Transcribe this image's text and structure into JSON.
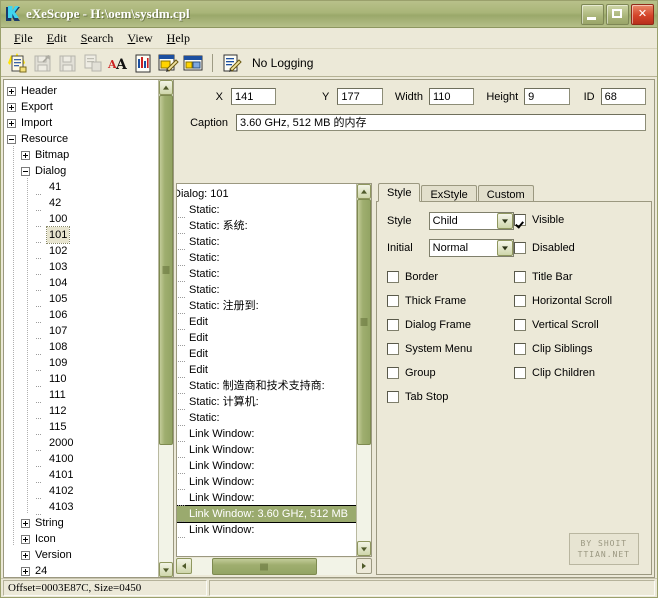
{
  "window": {
    "title": "eXeScope - H:\\oem\\sysdm.cpl",
    "icon": "app-icon",
    "minimize_label": "",
    "maximize_label": "",
    "close_label": "✕",
    "accent_title": "#a9b578",
    "accent_close": "#d4452a",
    "background": "#ece9d8"
  },
  "menu": {
    "items": [
      {
        "label": "File",
        "accel": "F",
        "rest": "ile"
      },
      {
        "label": "Edit",
        "accel": "E",
        "rest": "dit"
      },
      {
        "label": "Search",
        "accel": "S",
        "rest": "earch"
      },
      {
        "label": "View",
        "accel": "V",
        "rest": "iew"
      },
      {
        "label": "Help",
        "accel": "H",
        "rest": "elp"
      }
    ]
  },
  "toolbar": {
    "buttons": [
      {
        "name": "open-file-icon",
        "enabled": true
      },
      {
        "name": "save-as-icon",
        "enabled": false
      },
      {
        "name": "save-icon",
        "enabled": false
      },
      {
        "name": "save-copy-icon",
        "enabled": false
      },
      {
        "name": "font-icon",
        "enabled": true
      },
      {
        "name": "properties-icon",
        "enabled": true
      },
      {
        "name": "edit-resource-icon",
        "enabled": true
      },
      {
        "name": "dialog-editor-icon",
        "enabled": true
      },
      {
        "name": "logging-icon",
        "enabled": true
      }
    ],
    "logging_label": "No Logging"
  },
  "tree": {
    "items": [
      {
        "label": "Header",
        "depth": 0,
        "toggle": "plus"
      },
      {
        "label": "Export",
        "depth": 0,
        "toggle": "plus"
      },
      {
        "label": "Import",
        "depth": 0,
        "toggle": "plus"
      },
      {
        "label": "Resource",
        "depth": 0,
        "toggle": "minus"
      },
      {
        "label": "Bitmap",
        "depth": 1,
        "toggle": "plus"
      },
      {
        "label": "Dialog",
        "depth": 1,
        "toggle": "minus"
      },
      {
        "label": "41",
        "depth": 2,
        "toggle": "none"
      },
      {
        "label": "42",
        "depth": 2,
        "toggle": "none"
      },
      {
        "label": "100",
        "depth": 2,
        "toggle": "none"
      },
      {
        "label": "101",
        "depth": 2,
        "toggle": "none",
        "selected": true
      },
      {
        "label": "102",
        "depth": 2,
        "toggle": "none"
      },
      {
        "label": "103",
        "depth": 2,
        "toggle": "none"
      },
      {
        "label": "104",
        "depth": 2,
        "toggle": "none"
      },
      {
        "label": "105",
        "depth": 2,
        "toggle": "none"
      },
      {
        "label": "106",
        "depth": 2,
        "toggle": "none"
      },
      {
        "label": "107",
        "depth": 2,
        "toggle": "none"
      },
      {
        "label": "108",
        "depth": 2,
        "toggle": "none"
      },
      {
        "label": "109",
        "depth": 2,
        "toggle": "none"
      },
      {
        "label": "110",
        "depth": 2,
        "toggle": "none"
      },
      {
        "label": "111",
        "depth": 2,
        "toggle": "none"
      },
      {
        "label": "112",
        "depth": 2,
        "toggle": "none"
      },
      {
        "label": "115",
        "depth": 2,
        "toggle": "none"
      },
      {
        "label": "2000",
        "depth": 2,
        "toggle": "none"
      },
      {
        "label": "4100",
        "depth": 2,
        "toggle": "none"
      },
      {
        "label": "4101",
        "depth": 2,
        "toggle": "none"
      },
      {
        "label": "4102",
        "depth": 2,
        "toggle": "none"
      },
      {
        "label": "4103",
        "depth": 2,
        "toggle": "none"
      },
      {
        "label": "String",
        "depth": 1,
        "toggle": "plus"
      },
      {
        "label": "Icon",
        "depth": 1,
        "toggle": "plus"
      },
      {
        "label": "Version",
        "depth": 1,
        "toggle": "plus"
      },
      {
        "label": "24",
        "depth": 1,
        "toggle": "plus"
      }
    ]
  },
  "properties": {
    "x_label": "X",
    "x_value": "141",
    "y_label": "Y",
    "y_value": "177",
    "width_label": "Width",
    "width_value": "110",
    "height_label": "Height",
    "height_value": "9",
    "id_label": "ID",
    "id_value": "68",
    "caption_label": "Caption",
    "caption_value": "3.60 GHz, 512 MB 的内存"
  },
  "controls_list": {
    "header": "Dialog: 101",
    "items": [
      {
        "label": "Static:"
      },
      {
        "label": "Static: 系统:"
      },
      {
        "label": "Static:"
      },
      {
        "label": "Static:"
      },
      {
        "label": "Static:"
      },
      {
        "label": "Static:"
      },
      {
        "label": "Static: 注册到:"
      },
      {
        "label": "Edit"
      },
      {
        "label": "Edit"
      },
      {
        "label": "Edit"
      },
      {
        "label": "Edit"
      },
      {
        "label": "Static: 制造商和技术支持商:"
      },
      {
        "label": "Static: 计算机:"
      },
      {
        "label": "Static:"
      },
      {
        "label": "Link Window:"
      },
      {
        "label": "Link Window:"
      },
      {
        "label": "Link Window:"
      },
      {
        "label": "Link Window:"
      },
      {
        "label": "Link Window:"
      },
      {
        "label": "Link Window: 3.60 GHz, 512 MB",
        "selected": true
      },
      {
        "label": "Link Window:"
      }
    ],
    "selection_color": "#9aaa6e"
  },
  "style_panel": {
    "tabs": [
      {
        "label": "Style",
        "active": true
      },
      {
        "label": "ExStyle",
        "active": false
      },
      {
        "label": "Custom",
        "active": false
      }
    ],
    "style_label": "Style",
    "style_value": "Child",
    "initial_label": "Initial",
    "initial_value": "Normal",
    "checkboxes_top_right": [
      {
        "label": "Visible",
        "checked": true,
        "accel_index": 1
      },
      {
        "label": "Disabled",
        "checked": false,
        "accel_index": 0
      }
    ],
    "checkboxes_left": [
      {
        "label": "Border",
        "checked": false
      },
      {
        "label": "Thick Frame",
        "checked": false
      },
      {
        "label": "Dialog Frame",
        "checked": false
      },
      {
        "label": "System Menu",
        "checked": false
      },
      {
        "label": "Group",
        "checked": false
      },
      {
        "label": "Tab Stop",
        "checked": false
      }
    ],
    "checkboxes_right": [
      {
        "label": "Title Bar",
        "checked": false
      },
      {
        "label": "Horizontal Scroll",
        "checked": false
      },
      {
        "label": "Vertical Scroll",
        "checked": false
      },
      {
        "label": "Clip Siblings",
        "checked": false
      },
      {
        "label": "Clip Children",
        "checked": false
      }
    ],
    "watermark_line1": "BY SHOIT",
    "watermark_line2": "TTIAN.NET"
  },
  "status_bar": {
    "left": "Offset=0003E87C, Size=0450",
    "right": ""
  }
}
